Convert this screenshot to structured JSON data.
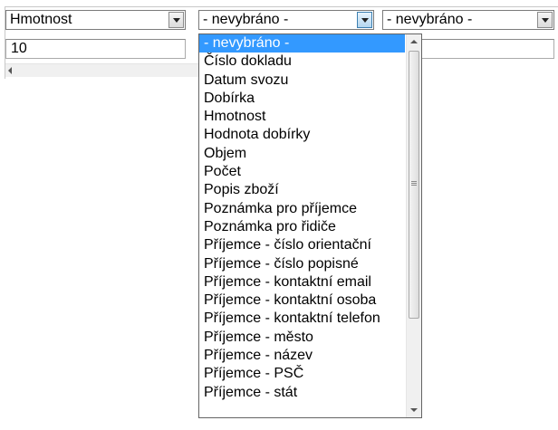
{
  "filters": [
    {
      "selected": "Hmotnost"
    },
    {
      "selected": "- nevybráno -"
    },
    {
      "selected": "- nevybráno -"
    }
  ],
  "value_input": {
    "value": "10"
  },
  "dropdown": {
    "options": [
      "- nevybráno -",
      "Číslo dokladu",
      "Datum svozu",
      "Dobírka",
      "Hmotnost",
      "Hodnota dobírky",
      "Objem",
      "Počet",
      "Popis zboží",
      "Poznámka pro příjemce",
      "Poznámka pro řidiče",
      "Příjemce - číslo orientační",
      "Příjemce - číslo popisné",
      "Příjemce - kontaktní email",
      "Příjemce - kontaktní osoba",
      "Příjemce - kontaktní telefon",
      "Příjemce - město",
      "Příjemce - název",
      "Příjemce - PSČ",
      "Příjemce - stát"
    ],
    "selected_index": 0
  },
  "colors": {
    "selection": "#3399ff"
  },
  "icons": [
    "chevron-down-icon",
    "arrow-up-icon",
    "arrow-down-icon",
    "arrow-left-icon",
    "scroll-grip-icon"
  ]
}
